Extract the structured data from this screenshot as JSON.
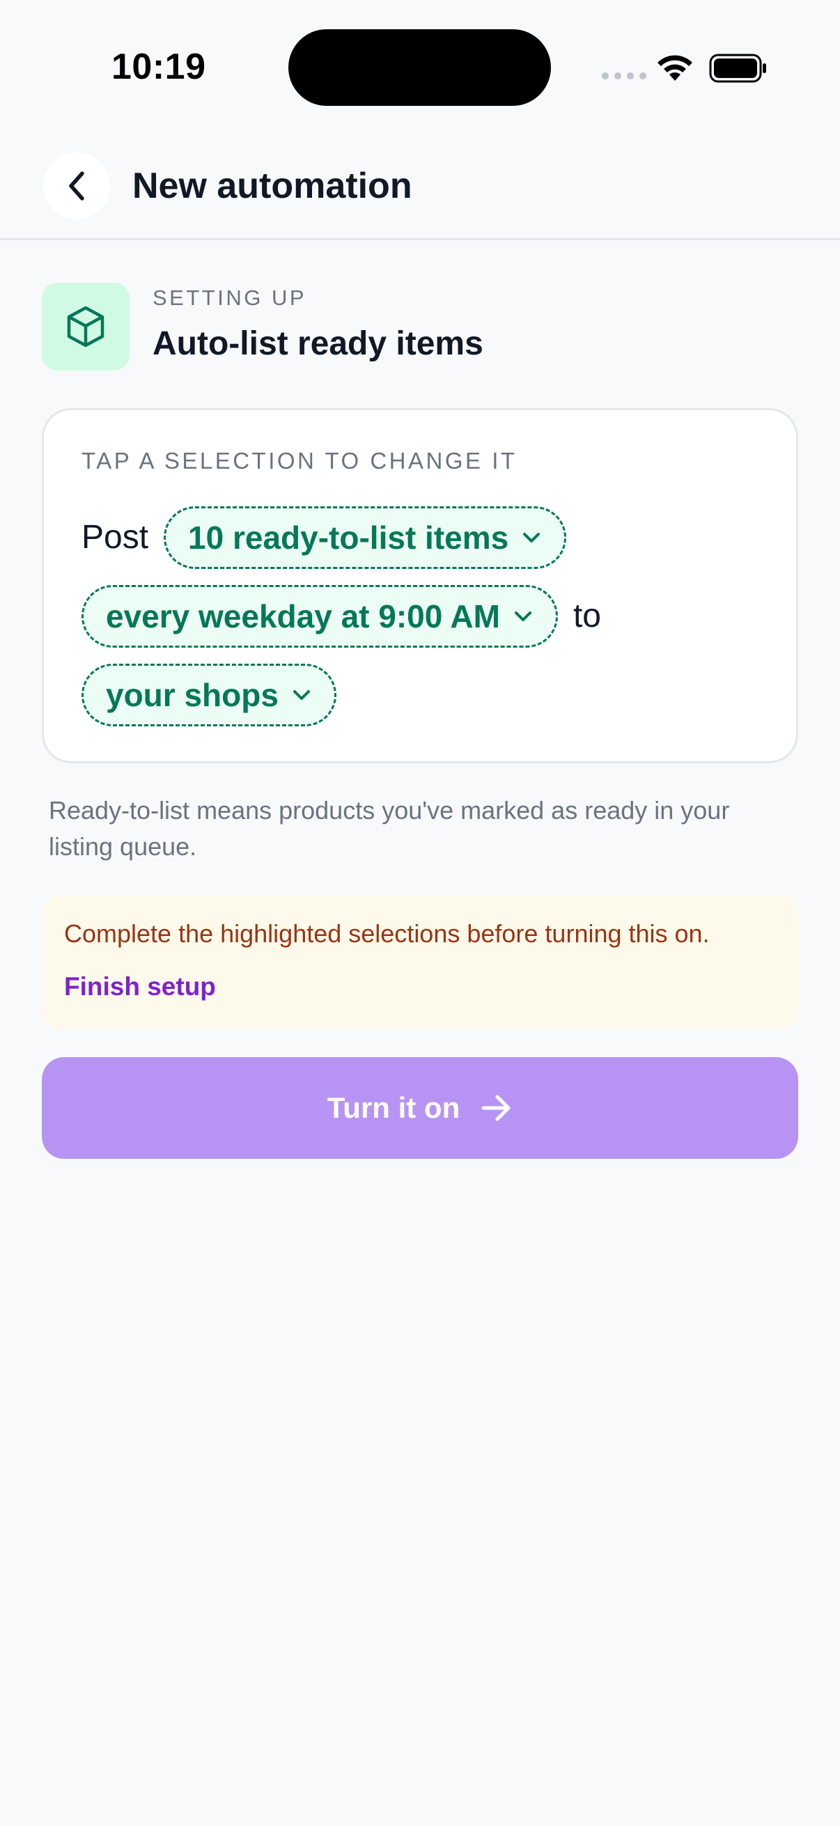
{
  "status_bar": {
    "time": "10:19"
  },
  "header": {
    "back_icon": "chevron-left-icon",
    "title": "New automation"
  },
  "setup": {
    "icon": "package-cube-icon",
    "eyebrow": "SETTING UP",
    "title": "Auto-list ready items"
  },
  "sentence_card": {
    "eyebrow": "TAP A SELECTION TO CHANGE IT",
    "word_post": "Post",
    "chip_items": "10 ready-to-list items",
    "chip_schedule": "every weekday at 9:00 AM",
    "word_to": "to",
    "chip_destination": "your shops"
  },
  "helper_text": "Ready-to-list means products you've marked as ready in your listing queue.",
  "warning": {
    "message": "Complete the highlighted selections before turning this on.",
    "link_label": "Finish setup"
  },
  "primary_button": {
    "label": "Turn it on",
    "icon": "arrow-right-icon"
  },
  "colors": {
    "accent_green": "#047857",
    "chip_bg": "#ECFDF5",
    "icon_box_bg": "#D1FAE5",
    "warning_bg": "#FEFAEB",
    "warning_text": "#9A3412",
    "link_purple": "#7E22CE",
    "button_disabled_purple": "#B794F4"
  }
}
